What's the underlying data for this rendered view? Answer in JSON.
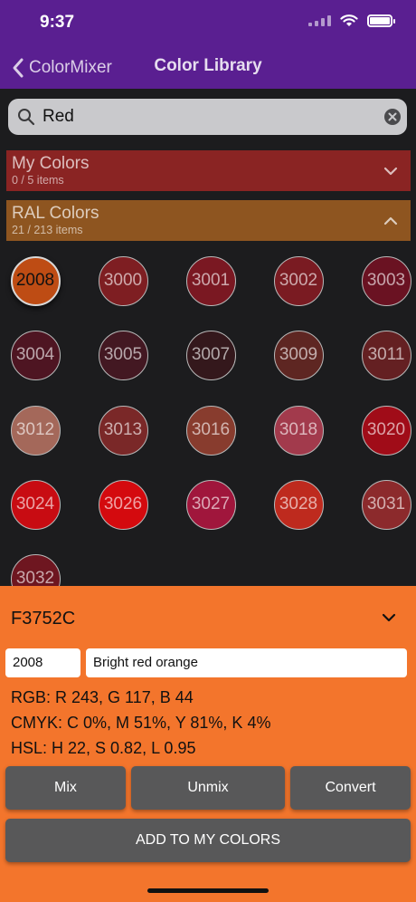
{
  "status": {
    "time": "9:37"
  },
  "nav": {
    "back_label": "ColorMixer",
    "title": "Color Library"
  },
  "search": {
    "value": "Red"
  },
  "sections": {
    "my_colors": {
      "title": "My Colors",
      "count": "0 / 5 items"
    },
    "ral_colors": {
      "title": "RAL Colors",
      "count": "21 / 213 items"
    }
  },
  "swatches": [
    {
      "code": "2008",
      "color": "#be4c14",
      "selected": true
    },
    {
      "code": "3000",
      "color": "#7e1e22"
    },
    {
      "code": "3001",
      "color": "#7a1822"
    },
    {
      "code": "3002",
      "color": "#7a1b22"
    },
    {
      "code": "3003",
      "color": "#6a1222"
    },
    {
      "code": "3004",
      "color": "#4e1522"
    },
    {
      "code": "3005",
      "color": "#431822"
    },
    {
      "code": "3007",
      "color": "#34181c"
    },
    {
      "code": "3009",
      "color": "#5e2622"
    },
    {
      "code": "3011",
      "color": "#642022"
    },
    {
      "code": "3012",
      "color": "#a4685a"
    },
    {
      "code": "3013",
      "color": "#7a2828"
    },
    {
      "code": "3016",
      "color": "#883c2e"
    },
    {
      "code": "3018",
      "color": "#a23a4c"
    },
    {
      "code": "3020",
      "color": "#a00c18"
    },
    {
      "code": "3024",
      "color": "#c80c12"
    },
    {
      "code": "3026",
      "color": "#d40a0e"
    },
    {
      "code": "3027",
      "color": "#a0163c"
    },
    {
      "code": "3028",
      "color": "#be2a1e"
    },
    {
      "code": "3031",
      "color": "#8c2a2c"
    },
    {
      "code": "3032",
      "color": "#6e1620"
    }
  ],
  "detail": {
    "hex": "F3752C",
    "code": "2008",
    "name": "Bright red orange",
    "rgb": "RGB: R 243, G 117, B 44",
    "cmyk": "CMYK: C 0%, M 51%, Y 81%, K 4%",
    "hsl": "HSL: H 22, S 0.82, L 0.95"
  },
  "buttons": {
    "mix": "Mix",
    "unmix": "Unmix",
    "convert": "Convert",
    "add": "ADD TO MY COLORS"
  },
  "colors": {
    "nav": "#5a1f91",
    "panel": "#f3752c",
    "my_colors_header": "#8a2423",
    "ral_header": "#8e5520"
  }
}
